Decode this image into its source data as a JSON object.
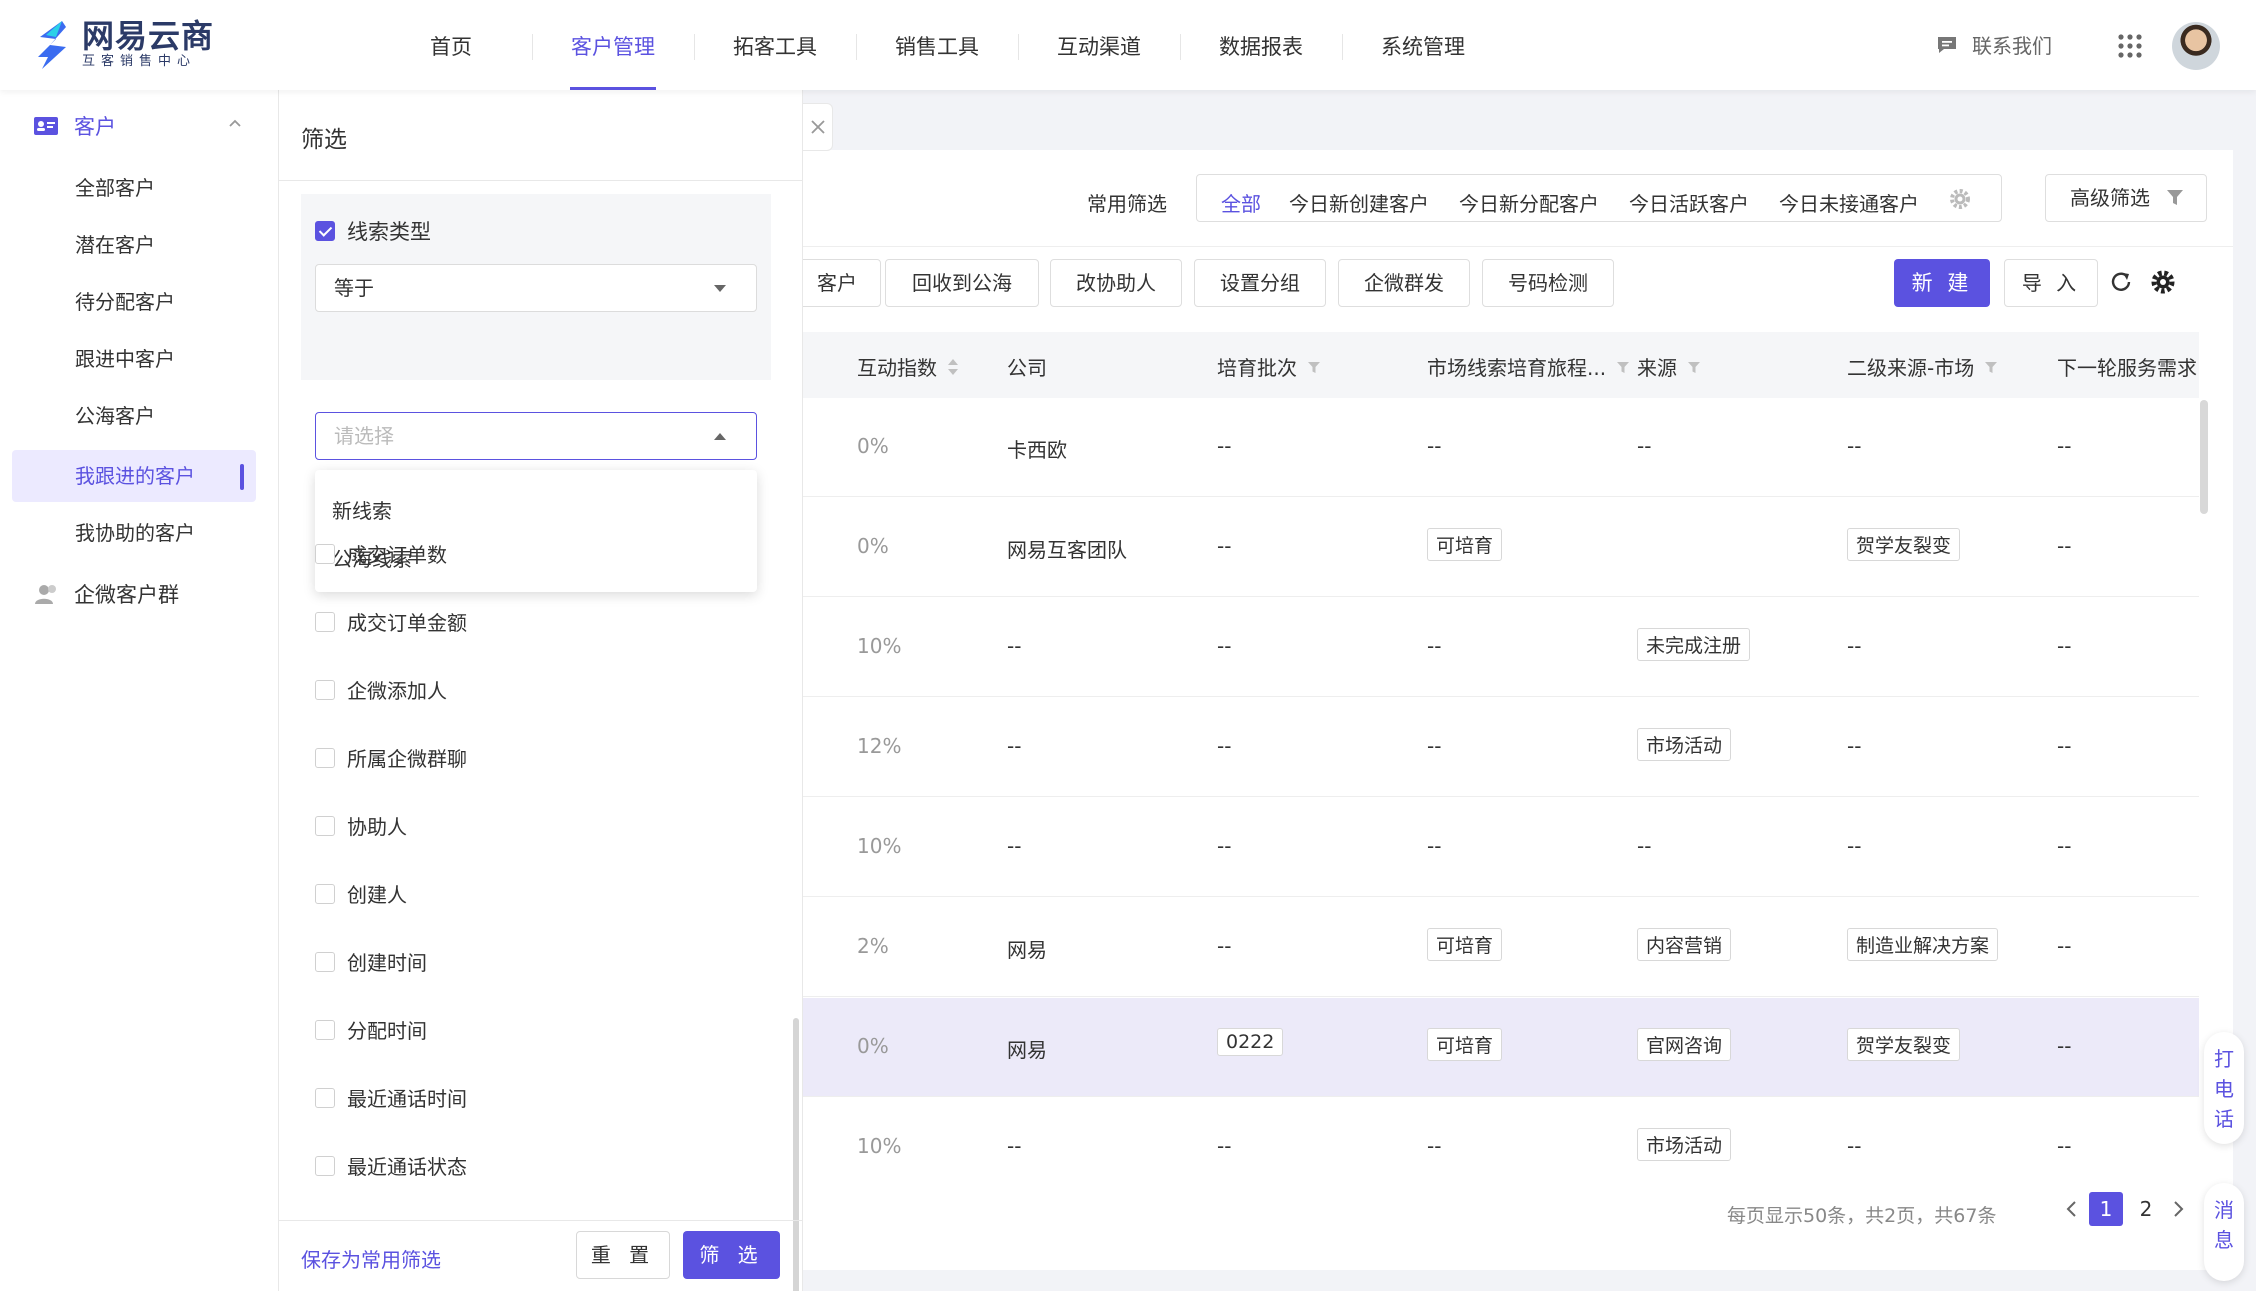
{
  "brand": {
    "title": "网易云商",
    "subtitle": "互客销售中心",
    "color": "#5b52e0"
  },
  "nav": {
    "items": [
      "首页",
      "客户管理",
      "拓客工具",
      "销售工具",
      "互动渠道",
      "数据报表",
      "系统管理"
    ],
    "active_index": 1,
    "contact_label": "联系我们"
  },
  "sidebar": {
    "group_customer": "客户",
    "items": [
      "全部客户",
      "潜在客户",
      "待分配客户",
      "跟进中客户",
      "公海客户",
      "我跟进的客户",
      "我协助的客户"
    ],
    "active_index": 5,
    "group_wecom": "企微客户群"
  },
  "filter_panel": {
    "title": "筛选",
    "condition": {
      "label": "线索类型",
      "checked": true,
      "operator": "等于",
      "value_placeholder": "请选择",
      "options": [
        "新线索",
        "公海线索"
      ]
    },
    "fields": [
      "成交订单数",
      "成交订单金额",
      "企微添加人",
      "所属企微群聊",
      "协助人",
      "创建人",
      "创建时间",
      "分配时间",
      "最近通话时间",
      "最近通话状态"
    ],
    "save_link": "保存为常用筛选",
    "reset_label": "重 置",
    "submit_label": "筛 选"
  },
  "quick_filter": {
    "label": "常用筛选",
    "options": [
      "全部",
      "今日新创建客户",
      "今日新分配客户",
      "今日活跃客户",
      "今日未接通客户"
    ],
    "active_index": 0,
    "advanced_label": "高级筛选"
  },
  "toolbar": {
    "buttons": [
      "客户",
      "回收到公海",
      "改协助人",
      "设置分组",
      "企微群发",
      "号码检测"
    ],
    "new_label": "新 建",
    "import_label": "导 入"
  },
  "table": {
    "columns": [
      "互动指数",
      "公司",
      "培育批次",
      "市场线索培育旅程...",
      "来源",
      "二级来源-市场",
      "下一轮服务需求"
    ],
    "rows": [
      [
        "0%",
        "卡西欧",
        "--",
        "--",
        "--",
        "--",
        "--"
      ],
      [
        "0%",
        "网易互客团队",
        "--",
        "可培育",
        "",
        "贺学友裂变",
        "--"
      ],
      [
        "10%",
        "--",
        "--",
        "--",
        "未完成注册",
        "--",
        "--"
      ],
      [
        "12%",
        "--",
        "--",
        "--",
        "市场活动",
        "--",
        "--"
      ],
      [
        "10%",
        "--",
        "--",
        "--",
        "--",
        "--",
        "--"
      ],
      [
        "2%",
        "网易",
        "--",
        "可培育",
        "内容营销",
        "制造业解决方案",
        "--"
      ],
      [
        "0%",
        "网易",
        "0222",
        "可培育",
        "官网咨询",
        "贺学友裂变",
        "--"
      ],
      [
        "10%",
        "--",
        "--",
        "--",
        "市场活动",
        "--",
        "--"
      ]
    ],
    "highlighted_row": 6
  },
  "pagination": {
    "info": "每页显示50条，共2页，共67条",
    "pages": [
      "1",
      "2"
    ],
    "current": "1"
  },
  "floating": {
    "call": "打电话",
    "message": "消息"
  }
}
